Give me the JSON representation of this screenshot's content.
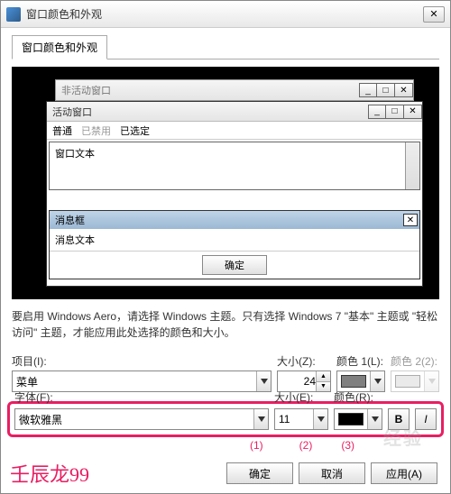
{
  "window": {
    "title": "窗口颜色和外观"
  },
  "tab": {
    "label": "窗口颜色和外观"
  },
  "preview": {
    "inactive_title": "非活动窗口",
    "active_title": "活动窗口",
    "menu": {
      "normal": "普通",
      "disabled": "已禁用",
      "selected": "已选定"
    },
    "window_text": "窗口文本",
    "msgbox_title": "消息框",
    "msgbox_text": "消息文本",
    "msgbox_ok": "确定"
  },
  "description": "要启用 Windows Aero，请选择 Windows 主题。只有选择 Windows 7 \"基本\" 主题或 \"轻松访问\" 主题，才能应用此处选择的颜色和大小。",
  "row1": {
    "item_label": "项目(I):",
    "item_value": "菜单",
    "size_label": "大小(Z):",
    "size_value": "24",
    "color1_label": "颜色 1(L):",
    "color1_value": "#808080",
    "color2_label": "颜色 2(2):"
  },
  "row2": {
    "font_label": "字体(F):",
    "font_value": "微软雅黑",
    "size_label": "大小(E):",
    "size_value": "11",
    "color_label": "颜色(R):",
    "color_value": "#000000",
    "bold": "B",
    "italic": "I"
  },
  "annotations": {
    "a1": "(1)",
    "a2": "(2)",
    "a3": "(3)"
  },
  "footer": {
    "ok": "确定",
    "cancel": "取消",
    "apply": "应用(A)"
  },
  "watermark": "壬辰龙99",
  "faint_watermark": "经验"
}
